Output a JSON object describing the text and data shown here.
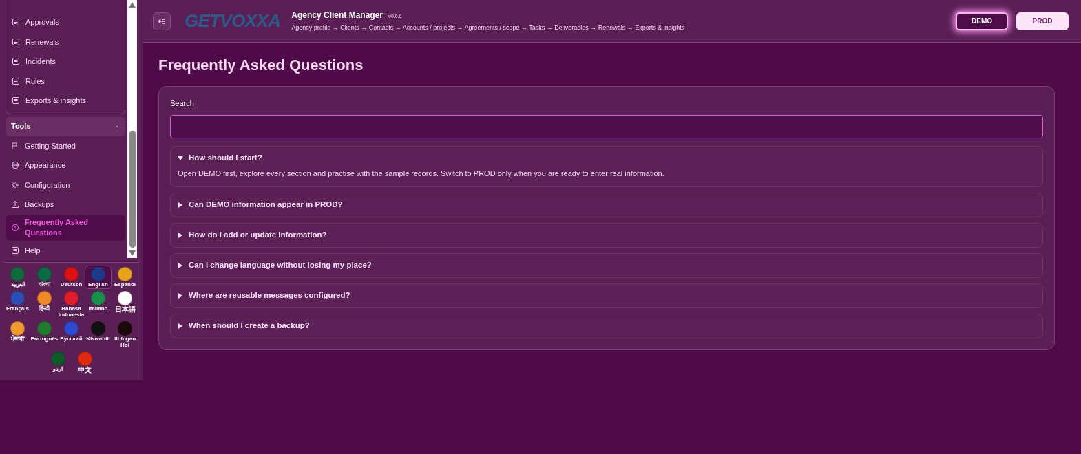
{
  "sidebar": {
    "groups": [
      {
        "items": [
          {
            "label": "Approvals",
            "selected": false
          },
          {
            "label": "Renewals",
            "selected": false
          },
          {
            "label": "Incidents",
            "selected": false
          },
          {
            "label": "Rules",
            "selected": false
          },
          {
            "label": "Exports & insights",
            "selected": false
          }
        ]
      },
      {
        "title": "Tools",
        "expanded": true,
        "items": [
          {
            "label": "Getting Started",
            "selected": false
          },
          {
            "label": "Appearance",
            "selected": false
          },
          {
            "label": "Configuration",
            "selected": false
          },
          {
            "label": "Backups",
            "selected": false
          },
          {
            "label": "Frequently Asked Questions",
            "selected": true
          },
          {
            "label": "Help",
            "selected": false
          }
        ]
      }
    ]
  },
  "languages": [
    {
      "label": "العربية",
      "color": "#0f6b3a",
      "selected": false
    },
    {
      "label": "বাংলা",
      "color": "#0a6a44",
      "selected": false
    },
    {
      "label": "Deutsch",
      "color": "#dd1111",
      "selected": false
    },
    {
      "label": "English",
      "color": "#1f3a8a",
      "selected": true
    },
    {
      "label": "Español",
      "color": "#e8a317",
      "selected": false
    },
    {
      "label": "Français",
      "color": "#2b4fb5",
      "selected": false
    },
    {
      "label": "हिन्दी",
      "color": "#f08a24",
      "selected": false
    },
    {
      "label": "Bahasa Indonesia",
      "color": "#e11d2a",
      "selected": false
    },
    {
      "label": "Italiano",
      "color": "#16904a",
      "selected": false
    },
    {
      "label": "日本語",
      "color": "#ffffff",
      "selected": false
    },
    {
      "label": "ਪੰਜਾਬੀ",
      "color": "#f29a2e",
      "selected": false
    },
    {
      "label": "Português",
      "color": "#1f7a2e",
      "selected": false
    },
    {
      "label": "Русский",
      "color": "#2c4bd1",
      "selected": false
    },
    {
      "label": "Kiswahili",
      "color": "#111111",
      "selected": false
    },
    {
      "label": "tlhIngan Hol",
      "color": "#1a0a0a",
      "selected": false
    },
    {
      "label": "اردو",
      "color": "#0f5a2a",
      "selected": false
    },
    {
      "label": "中文",
      "color": "#de2910",
      "selected": false
    }
  ],
  "header": {
    "logo": "GETVOXXA",
    "title": "Agency Client Manager",
    "version": "v0.0.0",
    "breadcrumb": "Agency profile → Clients → Contacts → Accounts / projects → Agreements / scope → Tasks → Deliverables → Renewals → Exports & insights",
    "modes": [
      {
        "label": "DEMO",
        "selected": true
      },
      {
        "label": "PROD",
        "selected": false
      }
    ]
  },
  "page": {
    "title": "Frequently Asked Questions",
    "search": {
      "label": "Search"
    },
    "faqs": [
      {
        "question": "How should I start?",
        "expanded": true,
        "answer": "Open DEMO first, explore every section and practise with the sample records. Switch to PROD only when you are ready to enter real information."
      },
      {
        "question": "Can DEMO information appear in PROD?",
        "expanded": false
      },
      {
        "question": "How do I add or update information?",
        "expanded": false
      },
      {
        "question": "Can I change language without losing my place?",
        "expanded": false
      },
      {
        "question": "Where are reusable messages configured?",
        "expanded": false
      },
      {
        "question": "When should I create a backup?",
        "expanded": false
      }
    ]
  }
}
